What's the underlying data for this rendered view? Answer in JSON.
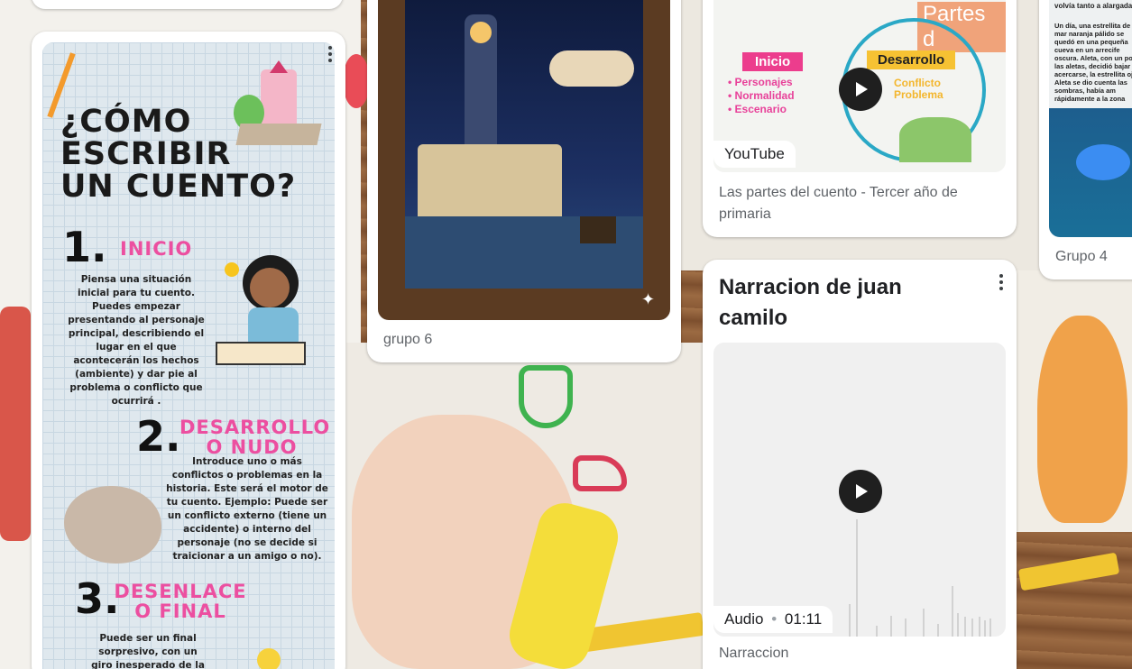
{
  "infographic": {
    "title_line1": "¿CÓMO",
    "title_line2": "ESCRIBIR",
    "title_line3": "UN CUENTO?",
    "step1_num": "1.",
    "step1_head": "INICIO",
    "step1_body": "Piensa una situación inicial para tu cuento. Puedes empezar presentando al personaje principal, describiendo el lugar en el que acontecerán los hechos (ambiente) y dar pie al problema o conflicto que ocurrirá .",
    "step2_num": "2.",
    "step2_head_line1": "DESARROLLO",
    "step2_head_line2": "O NUDO",
    "step2_body": "Introduce uno o más conflictos o problemas en la historia. Este será el motor de tu cuento. Ejemplo: Puede ser un conflicto externo (tiene un accidente) o interno del personaje (no se decide si traicionar a un amigo o no).",
    "step3_num": "3.",
    "step3_head_line1": "DESENLACE",
    "step3_head_line2": "O FINAL",
    "step3_body": "Puede ser un final sorpresivo, con un giro inesperado de la trama o"
  },
  "card_grupo6": {
    "caption": "grupo 6"
  },
  "card_youtube": {
    "source_badge": "YouTube",
    "title": "Las partes del cuento - Tercer año de primaria",
    "thumb_labels": {
      "inicio": "Inicio",
      "desarrollo": "Desarrollo",
      "bullets": [
        "• Personajes",
        "• Normalidad",
        "• Escenario"
      ],
      "conflicto": "Conflicto",
      "problema": "Problema",
      "partes": "Partes d"
    }
  },
  "card_grupo4": {
    "caption": "Grupo 4",
    "snippet": "Un día, una estrellita de mar naranja pálido se quedó en una pequeña cueva en un arrecife oscura. Aleta, con un poco las aletas, decidió bajar a acercarse, la estrellita ojo. Aleta se dio cuenta las sombras, había am rápidamente a la zona",
    "snippet_top": "volvía tanto a alargadas."
  },
  "card_audio": {
    "title": "Narracion de juan camilo",
    "badge_type": "Audio",
    "badge_separator": "•",
    "badge_duration": "01:11",
    "caption": "Narraccion"
  },
  "colors": {
    "pink": "#ec4fa0",
    "card_bg": "#ffffff",
    "caption": "#5f6368",
    "play": "#1f1f1f"
  }
}
